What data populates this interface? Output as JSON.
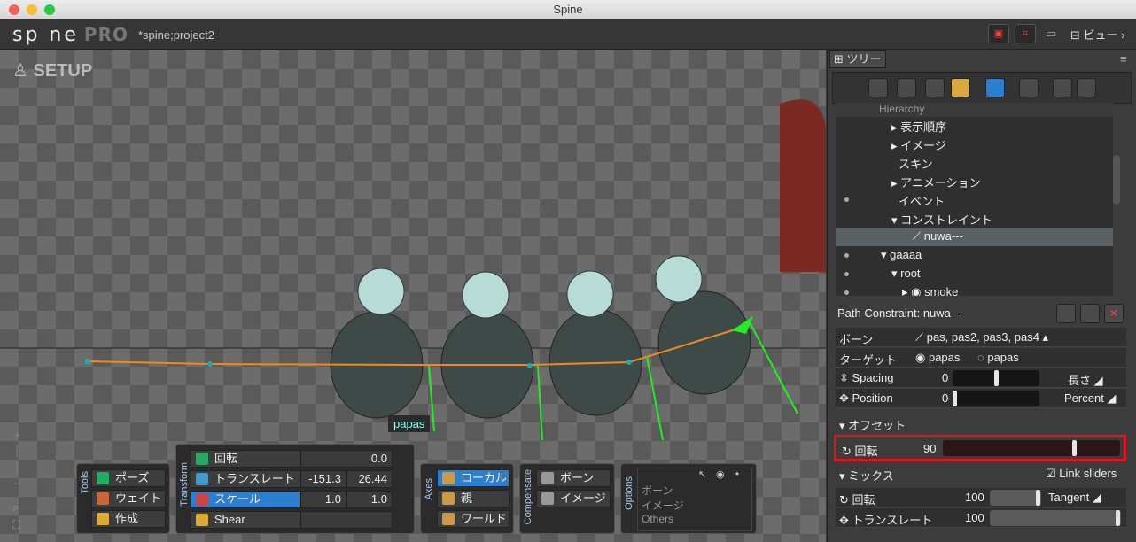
{
  "window": {
    "title": "Spine"
  },
  "app": {
    "logo": "sp ne",
    "edition": "PRO",
    "project": "*spine;project2",
    "view_label": "ビュー"
  },
  "viewport": {
    "mode": "SETUP",
    "bone_label": "papas"
  },
  "tools": {
    "group": "Tools",
    "items": [
      "ポーズ",
      "ウェイト",
      "作成"
    ]
  },
  "transform": {
    "group": "Transform",
    "rotate": "回転",
    "rotate_val": "0.0",
    "translate": "トランスレート",
    "tx": "-151.3",
    "ty": "26.44",
    "scale": "スケール",
    "sx": "1.0",
    "sy": "1.0",
    "shear": "Shear"
  },
  "axes": {
    "group": "Axes",
    "items": [
      "ローカル",
      "親",
      "ワールド"
    ]
  },
  "compensate": {
    "group": "Compensate",
    "items": [
      "ボーン",
      "イメージ"
    ]
  },
  "options": {
    "group": "Options",
    "rows": [
      "ボーン",
      "イメージ",
      "Others"
    ]
  },
  "tree": {
    "tab": "ツリー",
    "header": "Hierarchy",
    "nodes": [
      "表示順序",
      "イメージ",
      "スキン",
      "アニメーション",
      "イベント",
      "コンストレイント",
      "nuwa---",
      "gaaaa",
      "root",
      "smoke"
    ]
  },
  "props": {
    "title": "Path Constraint: nuwa---",
    "bone_label": "ボーン",
    "bones": "pas, pas2, pas3, pas4",
    "target_label": "ターゲット",
    "target1": "papas",
    "target2": "papas",
    "spacing_label": "Spacing",
    "spacing_val": "0",
    "spacing_mode": "長さ",
    "position_label": "Position",
    "position_val": "0",
    "position_mode": "Percent",
    "offset_header": "オフセット",
    "offset_rotate": "回転",
    "offset_rotate_val": "90",
    "mix_header": "ミックス",
    "link_sliders": "Link sliders",
    "mix_rotate": "回転",
    "mix_rotate_val": "100",
    "mix_rotate_mode": "Tangent",
    "mix_translate": "トランスレート",
    "mix_translate_val": "100"
  }
}
